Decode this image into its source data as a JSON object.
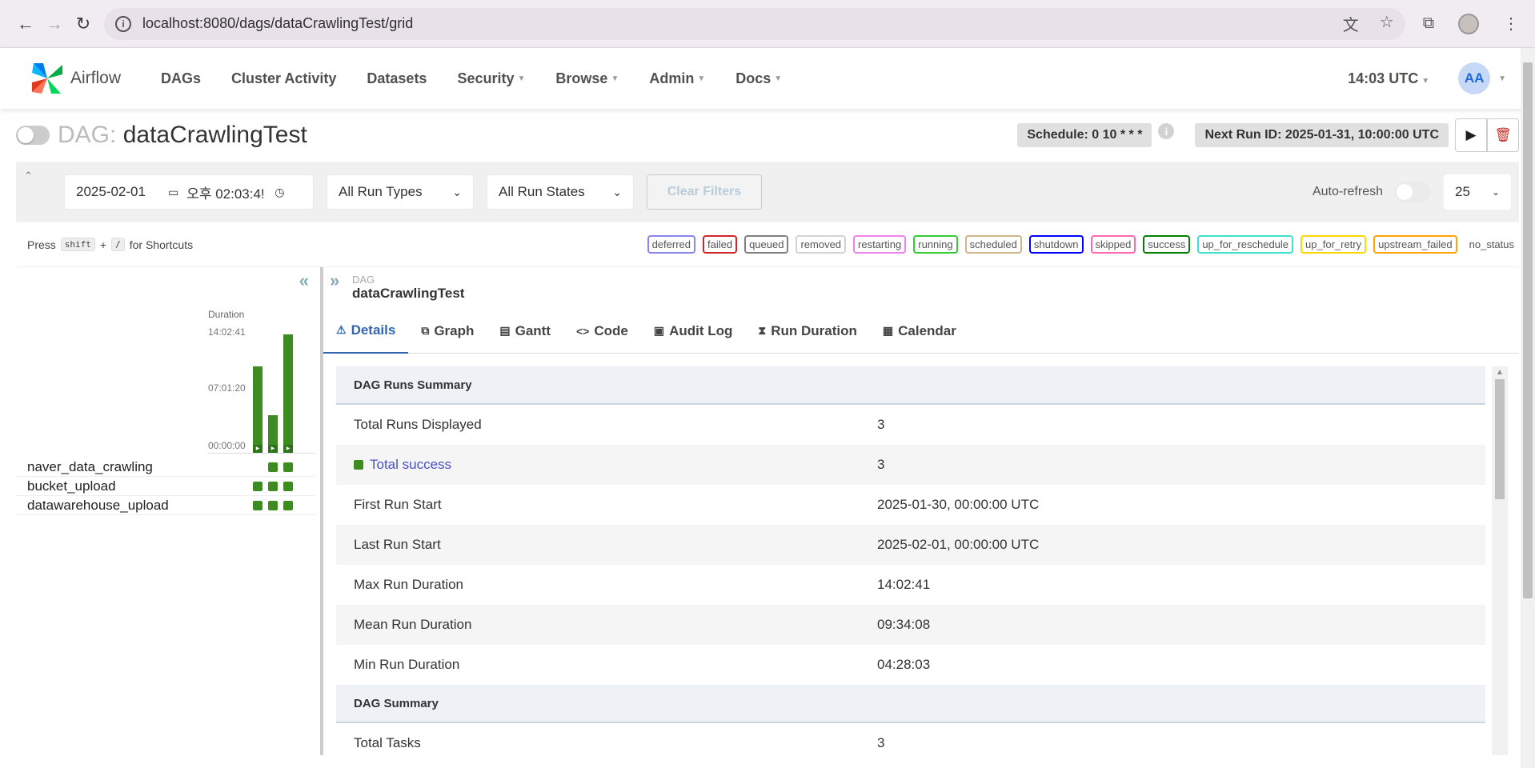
{
  "browser": {
    "url": "localhost:8080/dags/dataCrawlingTest/grid"
  },
  "navbar": {
    "logo_text": "Airflow",
    "items": [
      {
        "label": "DAGs",
        "dropdown": false
      },
      {
        "label": "Cluster Activity",
        "dropdown": false
      },
      {
        "label": "Datasets",
        "dropdown": false
      },
      {
        "label": "Security",
        "dropdown": true
      },
      {
        "label": "Browse",
        "dropdown": true
      },
      {
        "label": "Admin",
        "dropdown": true
      },
      {
        "label": "Docs",
        "dropdown": true
      }
    ],
    "time": "14:03 UTC",
    "user_initials": "AA"
  },
  "dag": {
    "label": "DAG:",
    "name": "dataCrawlingTest",
    "schedule": "Schedule: 0 10 * * *",
    "next_run": "Next Run ID: 2025-01-31, 10:00:00 UTC"
  },
  "filters": {
    "date": "2025-02-01",
    "time": "오후 02:03:4!",
    "run_types": "All Run Types",
    "run_states": "All Run States",
    "clear": "Clear Filters",
    "auto_refresh": "Auto-refresh",
    "page_size": "25"
  },
  "shortcuts": {
    "press": "Press",
    "key1": "shift",
    "plus": "+",
    "key2": "/",
    "suffix": "for Shortcuts"
  },
  "states": [
    {
      "label": "deferred",
      "color": "#8a85e8"
    },
    {
      "label": "failed",
      "color": "#d0262c"
    },
    {
      "label": "queued",
      "color": "#808080"
    },
    {
      "label": "removed",
      "color": "#d3d3d3"
    },
    {
      "label": "restarting",
      "color": "#ee82ee"
    },
    {
      "label": "running",
      "color": "#32cd32"
    },
    {
      "label": "scheduled",
      "color": "#d2b48c"
    },
    {
      "label": "shutdown",
      "color": "#0000ff"
    },
    {
      "label": "skipped",
      "color": "#ff69b4"
    },
    {
      "label": "success",
      "color": "#008000"
    },
    {
      "label": "up_for_reschedule",
      "color": "#40e0d0"
    },
    {
      "label": "up_for_retry",
      "color": "#ffd700"
    },
    {
      "label": "upstream_failed",
      "color": "#ffa500"
    },
    {
      "label": "no_status",
      "color": "#ffffff"
    }
  ],
  "grid": {
    "duration_label": "Duration",
    "ticks": [
      "14:02:41",
      "07:01:20",
      "00:00:00"
    ],
    "run_durations_hours": [
      10.2,
      4.47,
      14.04
    ],
    "max_hours": 14.04,
    "tasks": [
      "naver_data_crawling",
      "bucket_upload",
      "datawarehouse_upload"
    ],
    "task_runs": [
      [
        false,
        true,
        true
      ],
      [
        true,
        true,
        true
      ],
      [
        true,
        true,
        true
      ]
    ]
  },
  "details": {
    "breadcrumb_label": "DAG",
    "breadcrumb_title": "dataCrawlingTest",
    "tabs": [
      {
        "label": "Details",
        "icon": "⚠",
        "active": true
      },
      {
        "label": "Graph",
        "icon": "⧉",
        "active": false
      },
      {
        "label": "Gantt",
        "icon": "▤",
        "active": false
      },
      {
        "label": "Code",
        "icon": "<>",
        "active": false
      },
      {
        "label": "Audit Log",
        "icon": "▣",
        "active": false
      },
      {
        "label": "Run Duration",
        "icon": "⧗",
        "active": false
      },
      {
        "label": "Calendar",
        "icon": "▦",
        "active": false
      }
    ],
    "runs_summary_title": "DAG Runs Summary",
    "rows": [
      {
        "key": "Total Runs Displayed",
        "value": "3"
      },
      {
        "key": "Total success",
        "value": "3"
      },
      {
        "key": "First Run Start",
        "value": "2025-01-30, 00:00:00 UTC"
      },
      {
        "key": "Last Run Start",
        "value": "2025-02-01, 00:00:00 UTC"
      },
      {
        "key": "Max Run Duration",
        "value": "14:02:41"
      },
      {
        "key": "Mean Run Duration",
        "value": "09:34:08"
      },
      {
        "key": "Min Run Duration",
        "value": "04:28:03"
      }
    ],
    "dag_summary_title": "DAG Summary",
    "dag_summary_rows": [
      {
        "key": "Total Tasks",
        "value": "3"
      }
    ]
  }
}
